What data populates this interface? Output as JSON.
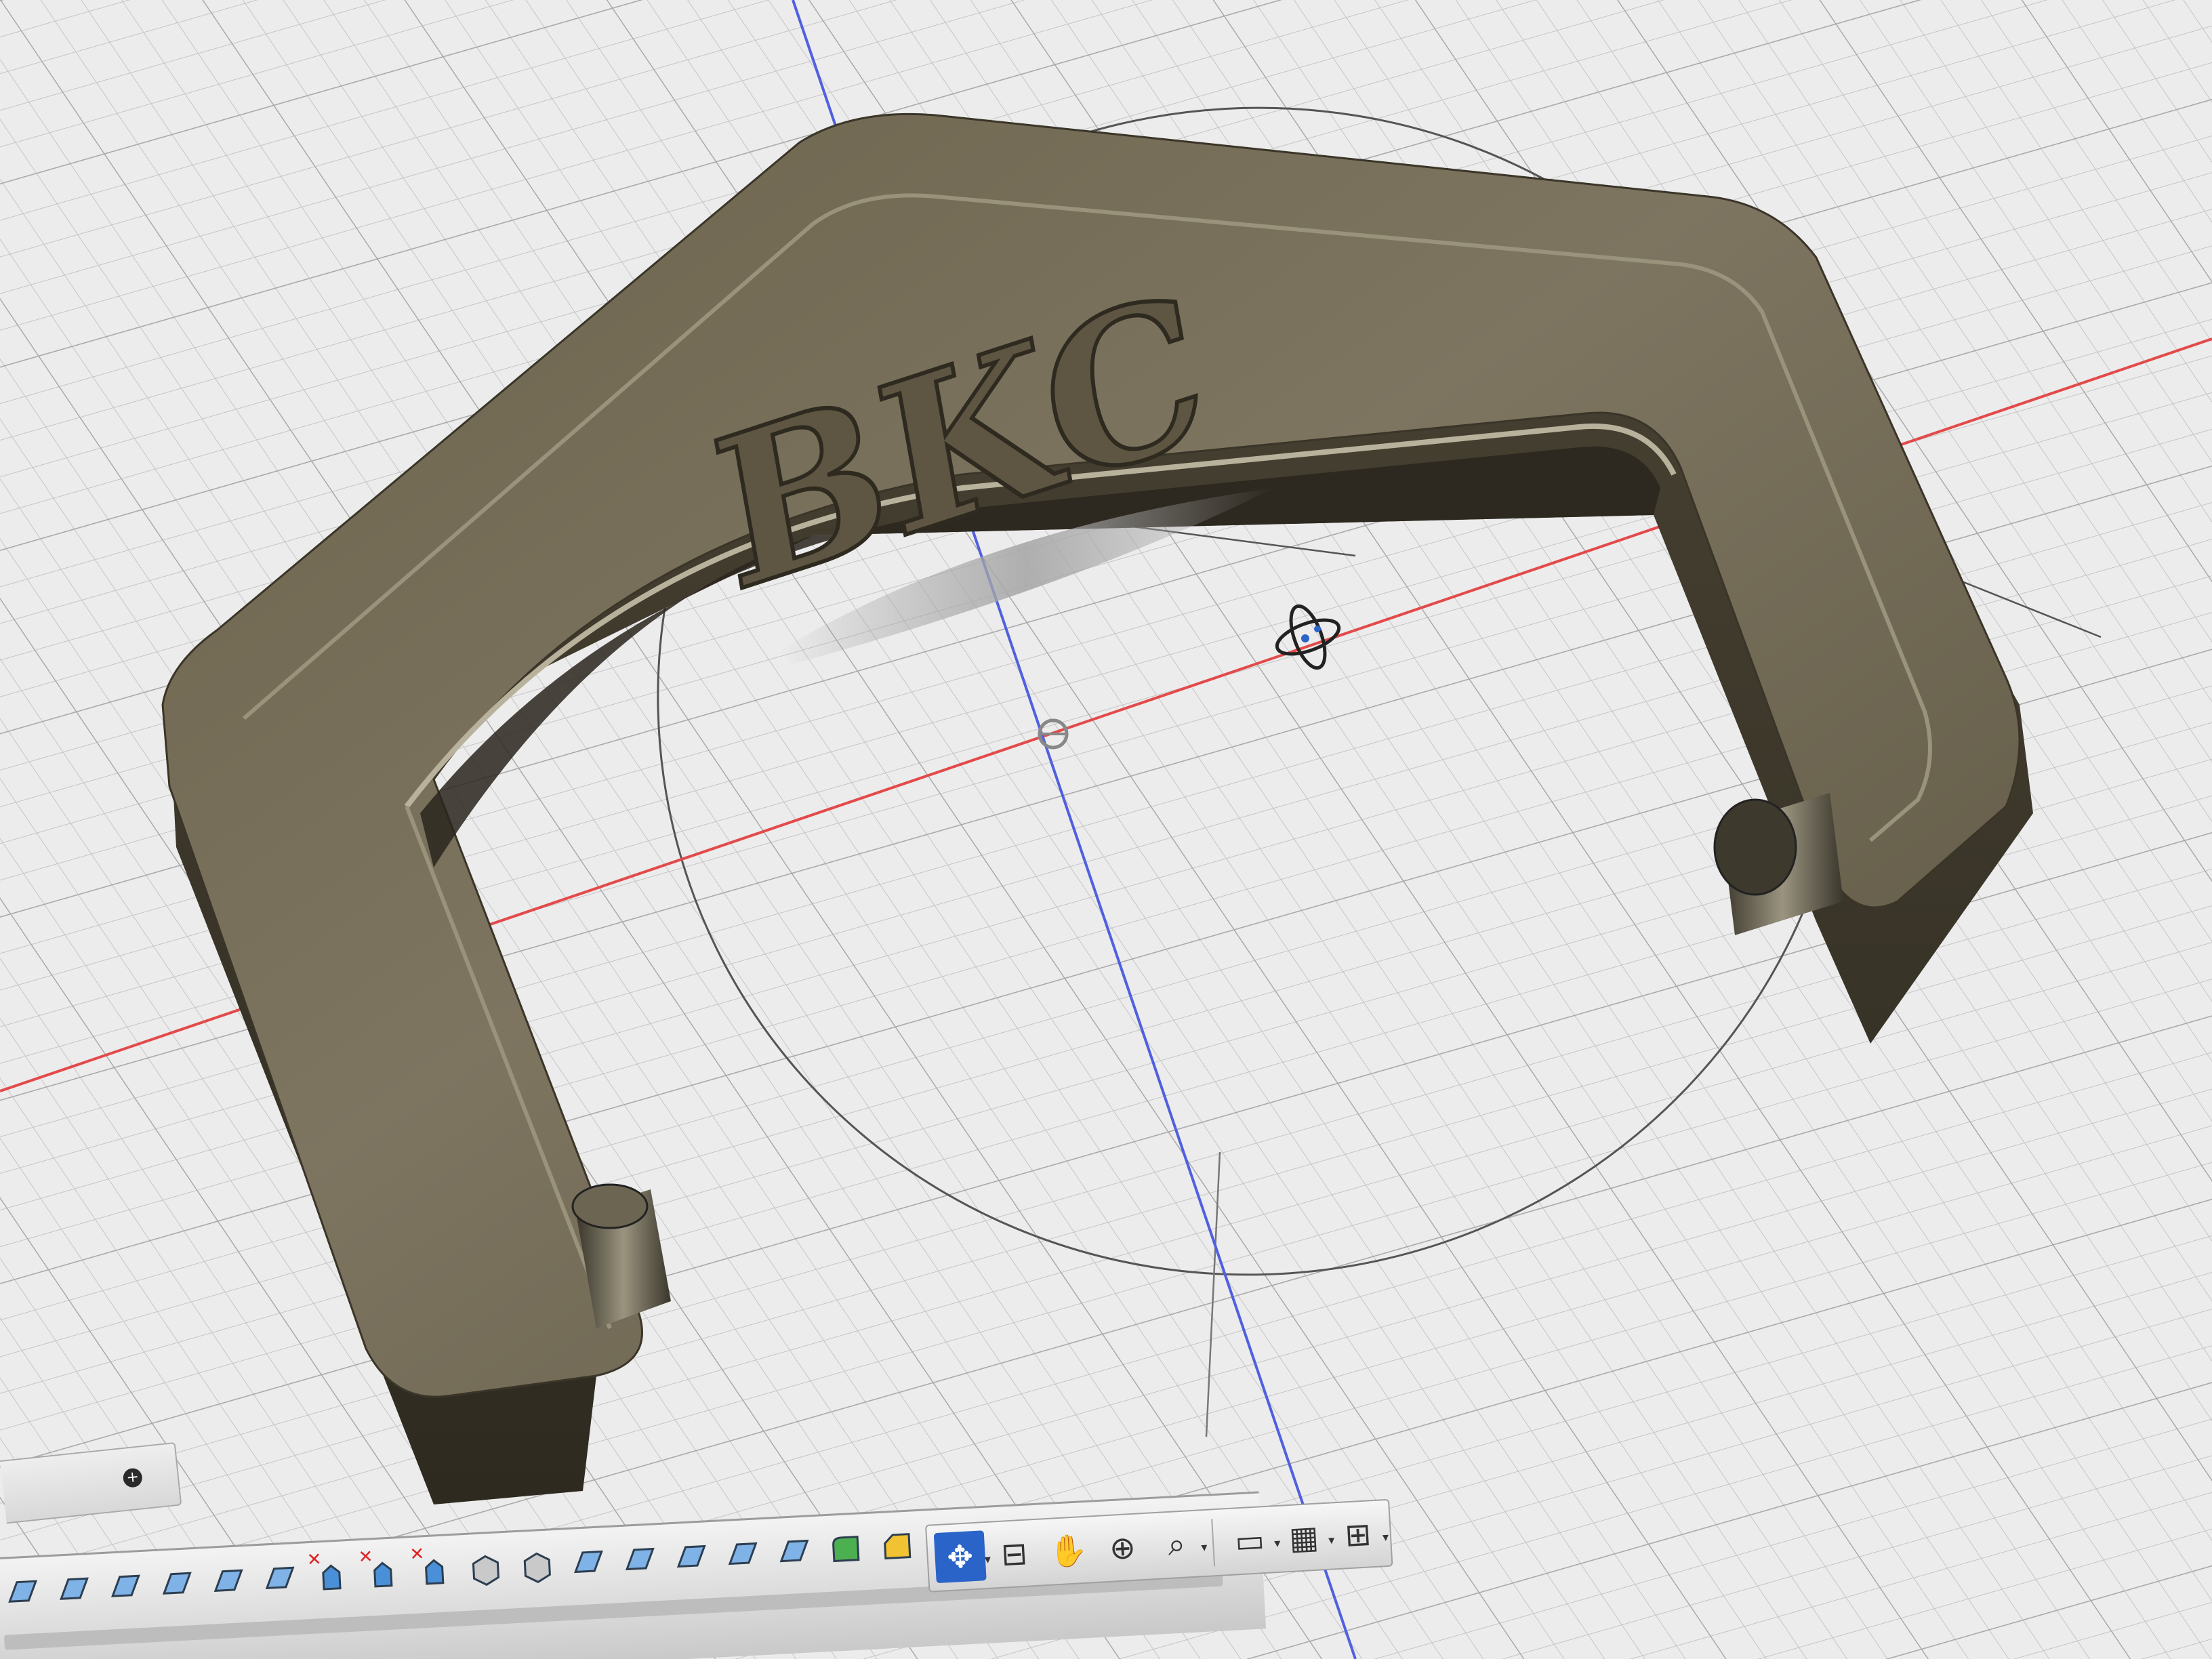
{
  "app": {
    "part_label": "BKC"
  },
  "colors": {
    "background_grid": "#e9e9e9",
    "x_axis": "#e34a4a",
    "y_axis": "#5060e0",
    "model_metal": "#6e6650",
    "nav_active": "#2a64c8"
  },
  "browser_panel": {
    "add_icon": "plus-circle-icon"
  },
  "nav_bar": {
    "tools": [
      {
        "name": "orbit-icon",
        "glyph": "✥",
        "active": true,
        "dropdown": true
      },
      {
        "name": "look-at-icon",
        "glyph": "⊟",
        "active": false,
        "dropdown": false
      },
      {
        "name": "pan-hand-icon",
        "glyph": "✋",
        "active": false,
        "dropdown": false
      },
      {
        "name": "zoom-icon",
        "glyph": "⊕",
        "active": false,
        "dropdown": false
      },
      {
        "name": "zoom-window-icon",
        "glyph": "⌕",
        "active": false,
        "dropdown": true
      },
      {
        "name": "display-settings-icon",
        "glyph": "▭",
        "active": false,
        "dropdown": true
      },
      {
        "name": "grid-snaps-icon",
        "glyph": "▦",
        "active": false,
        "dropdown": true
      },
      {
        "name": "viewports-icon",
        "glyph": "⊞",
        "active": false,
        "dropdown": true
      }
    ]
  },
  "timeline": {
    "steps": [
      {
        "name": "sketch-step-icon",
        "error": false
      },
      {
        "name": "sketch-step-icon",
        "error": false
      },
      {
        "name": "sketch-step-icon",
        "error": false
      },
      {
        "name": "sketch-step-icon",
        "error": false
      },
      {
        "name": "sketch-step-icon",
        "error": false
      },
      {
        "name": "sketch-step-icon",
        "error": false
      },
      {
        "name": "move-step-icon",
        "error": true
      },
      {
        "name": "move-step-icon",
        "error": true
      },
      {
        "name": "move-step-icon",
        "error": true
      },
      {
        "name": "extrude-step-icon",
        "error": false
      },
      {
        "name": "extrude-step-icon",
        "error": false
      },
      {
        "name": "sketch-step-icon",
        "error": false
      },
      {
        "name": "sketch-step-icon",
        "error": false
      },
      {
        "name": "sketch-step-icon",
        "error": false
      },
      {
        "name": "sketch-step-icon",
        "error": false
      },
      {
        "name": "sketch-step-icon",
        "error": false
      },
      {
        "name": "fillet-step-icon",
        "error": false
      },
      {
        "name": "chamfer-step-icon",
        "error": false
      },
      {
        "name": "chamfer-step-icon",
        "error": false
      },
      {
        "name": "extrude-step-icon",
        "error": false
      },
      {
        "name": "chamfer-step-icon",
        "error": false
      }
    ],
    "error_mark": "✕"
  }
}
